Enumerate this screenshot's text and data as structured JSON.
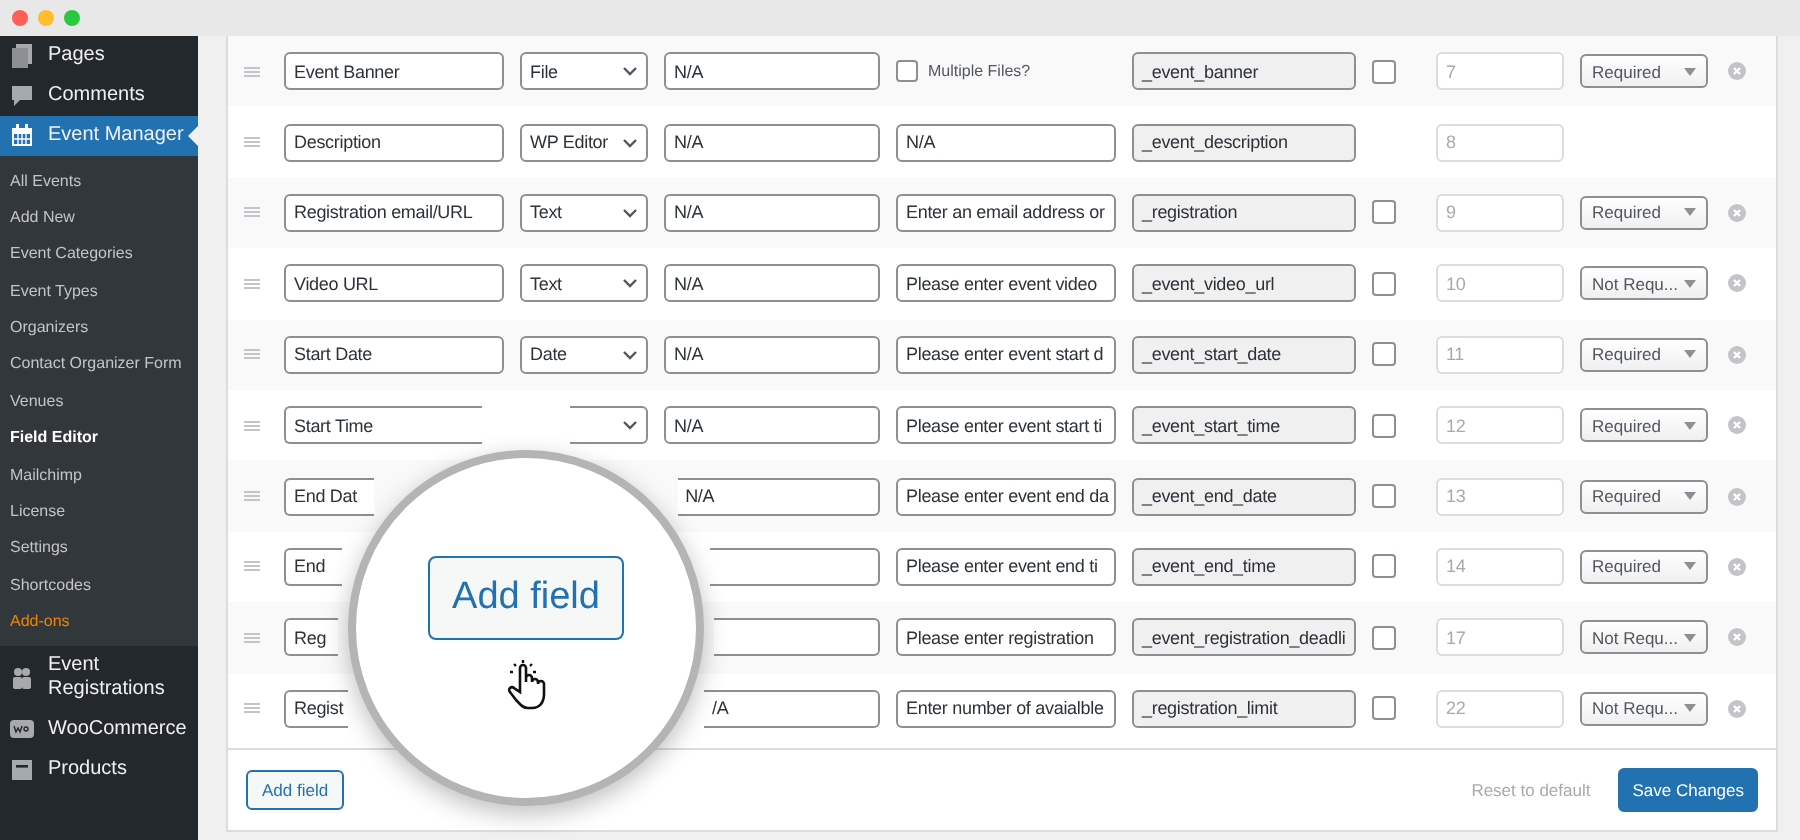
{
  "sidebar": {
    "items": [
      {
        "label": "Pages",
        "selected": false
      },
      {
        "label": "Comments",
        "selected": false
      },
      {
        "label": "Event Manager",
        "selected": true,
        "children": [
          {
            "label": "All Events",
            "selected": false,
            "kind": "normal"
          },
          {
            "label": "Add New",
            "selected": false,
            "kind": "normal"
          },
          {
            "label": "Event Categories",
            "selected": false,
            "kind": "normal"
          },
          {
            "label": "Event Types",
            "selected": false,
            "kind": "normal"
          },
          {
            "label": "Organizers",
            "selected": false,
            "kind": "normal"
          },
          {
            "label": "Contact Organizer Form",
            "selected": false,
            "kind": "normal"
          },
          {
            "label": "Venues",
            "selected": false,
            "kind": "normal"
          },
          {
            "label": "Field Editor",
            "selected": true,
            "kind": "normal"
          },
          {
            "label": "Mailchimp",
            "selected": false,
            "kind": "normal"
          },
          {
            "label": "License",
            "selected": false,
            "kind": "normal"
          },
          {
            "label": "Settings",
            "selected": false,
            "kind": "normal"
          },
          {
            "label": "Shortcodes",
            "selected": false,
            "kind": "normal"
          },
          {
            "label": "Add-ons",
            "selected": false,
            "kind": "highlight"
          }
        ]
      },
      {
        "label": "Event Registrations",
        "selected": false
      },
      {
        "label": "WooCommerce",
        "selected": false
      },
      {
        "label": "Products",
        "selected": false
      }
    ]
  },
  "rows": [
    {
      "label": "Event Banner",
      "type": "File",
      "placeholder": "N/A",
      "extra": {
        "kind": "checkbox",
        "label": "Multiple Files?",
        "checked": false
      },
      "meta_key": "_event_banner",
      "flag": {
        "checked": false
      },
      "priority": "7",
      "requirement": "Required"
    },
    {
      "label": "Description",
      "type": "WP Editor",
      "placeholder": "N/A",
      "extra": {
        "kind": "text",
        "value": "N/A"
      },
      "meta_key": "_event_description",
      "priority": "8"
    },
    {
      "label": "Registration email/URL",
      "type": "Text",
      "placeholder": "N/A",
      "extra": {
        "kind": "text",
        "value": "Enter an email address or"
      },
      "meta_key": "_registration",
      "flag": {
        "checked": false
      },
      "priority": "9",
      "requirement": "Required"
    },
    {
      "label": "Video URL",
      "type": "Text",
      "placeholder": "N/A",
      "extra": {
        "kind": "text",
        "value": "Please enter event video"
      },
      "meta_key": "_event_video_url",
      "flag": {
        "checked": false
      },
      "priority": "10",
      "requirement": "Not Requ..."
    },
    {
      "label": "Start Date",
      "type": "Date",
      "placeholder": "N/A",
      "extra": {
        "kind": "text",
        "value": "Please enter event start d"
      },
      "meta_key": "_event_start_date",
      "flag": {
        "checked": false
      },
      "priority": "11",
      "requirement": "Required"
    },
    {
      "label": "Start Time",
      "placeholder": "N/A",
      "extra": {
        "kind": "text",
        "value": "Please enter event start ti"
      },
      "meta_key": "_event_start_time",
      "flag": {
        "checked": false
      },
      "priority": "12",
      "requirement": "Required"
    },
    {
      "label": "End Dat",
      "placeholder": "N/A",
      "extra": {
        "kind": "text",
        "value": "Please enter event end da"
      },
      "meta_key": "_event_end_date",
      "flag": {
        "checked": false
      },
      "priority": "13",
      "requirement": "Required"
    },
    {
      "label": "End",
      "extra": {
        "kind": "text",
        "value": "Please enter event end ti"
      },
      "meta_key": "_event_end_time",
      "flag": {
        "checked": false
      },
      "priority": "14",
      "requirement": "Required"
    },
    {
      "label": "Reg",
      "extra": {
        "kind": "text",
        "value": "Please enter registration"
      },
      "meta_key": "_event_registration_deadli",
      "flag": {
        "checked": false
      },
      "priority": "17",
      "requirement": "Not Requ..."
    },
    {
      "label": "Regist",
      "placeholder": "/A",
      "extra": {
        "kind": "text",
        "value": "Enter number of avaialble"
      },
      "meta_key": "_registration_limit",
      "flag": {
        "checked": false
      },
      "priority": "22",
      "requirement": "Not Requ..."
    }
  ],
  "footer": {
    "add_button": "Add field",
    "reset_link": "Reset to default",
    "save_button": "Save Changes"
  },
  "magnifier": {
    "button": "Add field"
  }
}
